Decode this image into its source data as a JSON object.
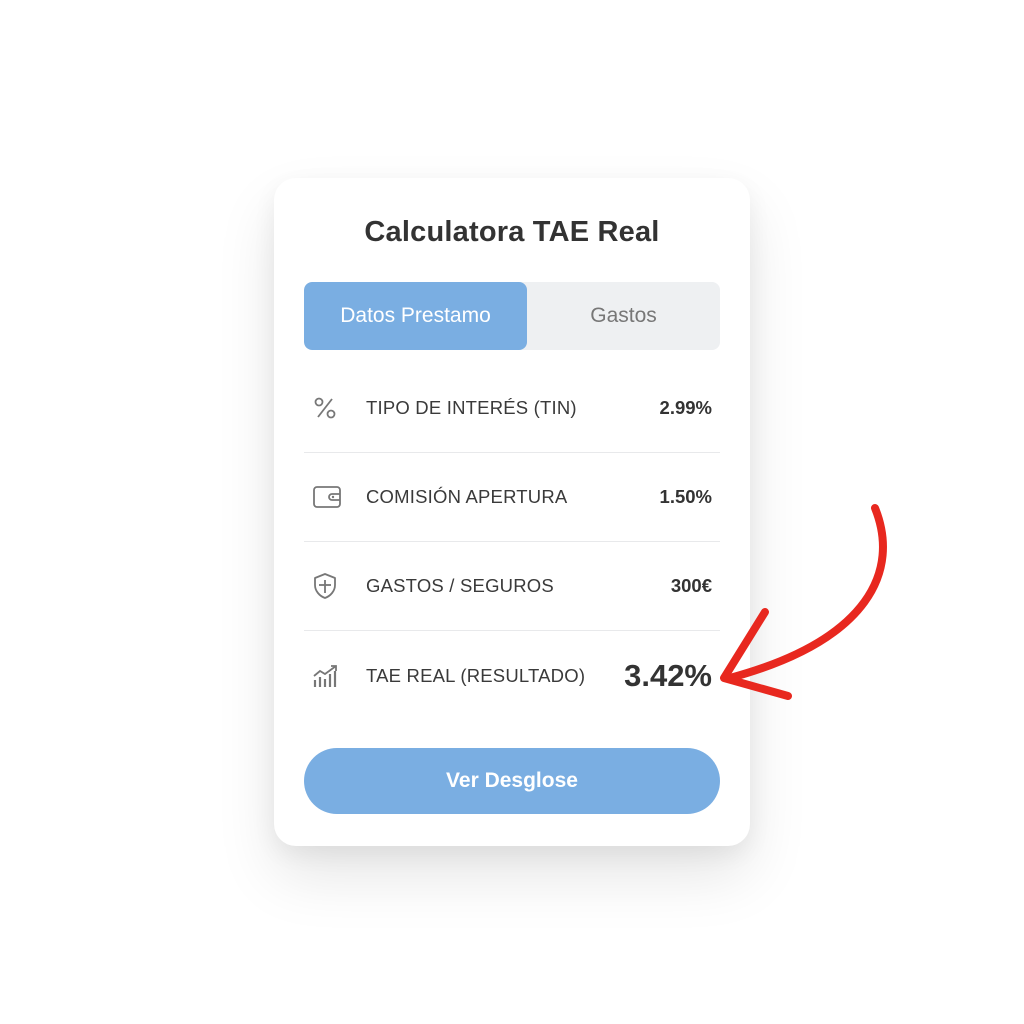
{
  "calculator": {
    "title": "Calculatora TAE Real",
    "tabs": [
      {
        "label": "Datos Prestamo",
        "active": true
      },
      {
        "label": "Gastos",
        "active": false
      }
    ],
    "rows": [
      {
        "icon": "percent-icon",
        "label": "TIPO DE INTERÉS (TIN)",
        "value": "2.99%"
      },
      {
        "icon": "wallet-icon",
        "label": "COMISIÓN APERTURA",
        "value": "1.50%"
      },
      {
        "icon": "shield-icon",
        "label": "GASTOS / SEGUROS",
        "value": "300€"
      },
      {
        "icon": "chart-growth-icon",
        "label": "TAE REAL (RESULTADO)",
        "value": "3.42%"
      }
    ],
    "cta_label": "Ver Desglose"
  },
  "colors": {
    "accent": "#7aaee2",
    "annotation_arrow": "#e8281f",
    "tab_bg": "#eef0f2",
    "text": "#333333"
  }
}
